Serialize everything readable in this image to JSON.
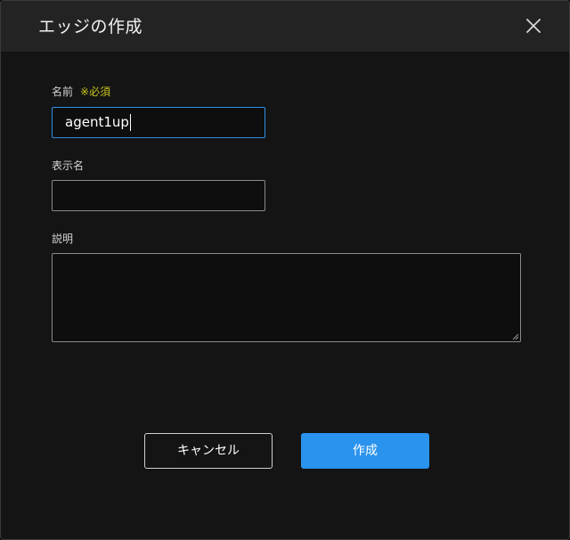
{
  "dialog": {
    "title": "エッジの作成",
    "close_icon": "close-icon"
  },
  "form": {
    "name": {
      "label": "名前",
      "required_mark": "※必須",
      "value": "agent1up"
    },
    "display_name": {
      "label": "表示名",
      "value": ""
    },
    "description": {
      "label": "説明",
      "value": ""
    }
  },
  "buttons": {
    "cancel_label": "キャンセル",
    "create_label": "作成"
  },
  "colors": {
    "accent": "#2a93ee",
    "focus_border": "#2f8fe6",
    "required": "#c7c41e",
    "background": "#141414",
    "header": "#232323"
  }
}
